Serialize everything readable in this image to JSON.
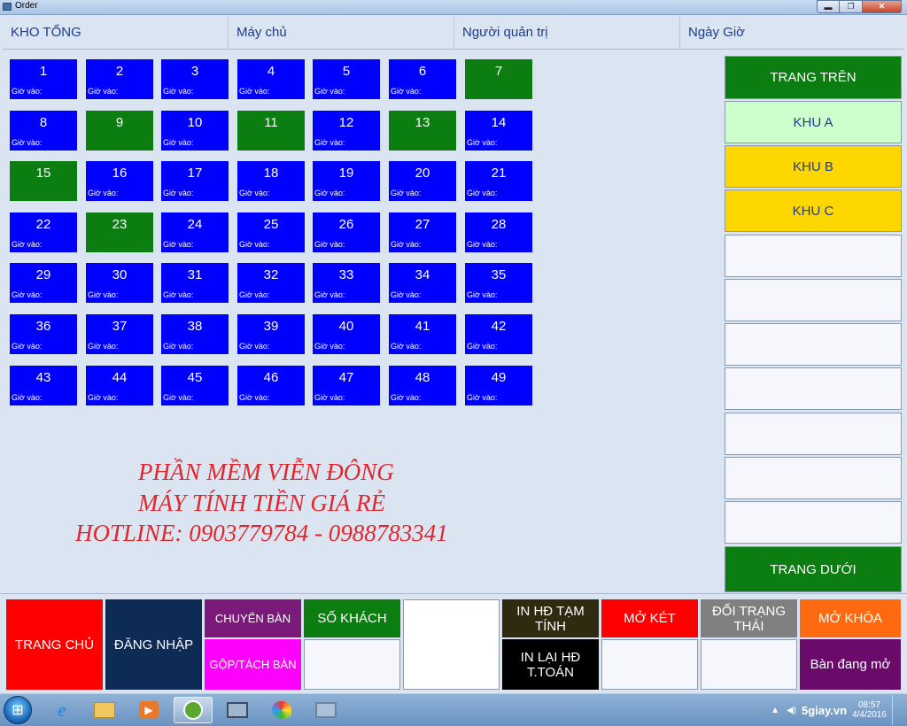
{
  "window": {
    "title": "Order",
    "min_label": "▬",
    "max_label": "❐",
    "close_label": "✕"
  },
  "header": {
    "area": "KHO TỔNG",
    "server": "Máy chủ",
    "user": "Người quản trị",
    "datetime": "Ngày  Giờ"
  },
  "tables": {
    "time_label": "Giờ vào:",
    "colors": {
      "empty": "#0000ff",
      "busy": "#0b7d11"
    },
    "items": [
      {
        "num": "1",
        "busy": false
      },
      {
        "num": "2",
        "busy": false
      },
      {
        "num": "3",
        "busy": false
      },
      {
        "num": "4",
        "busy": false
      },
      {
        "num": "5",
        "busy": false
      },
      {
        "num": "6",
        "busy": false
      },
      {
        "num": "7",
        "busy": true
      },
      {
        "num": "8",
        "busy": false
      },
      {
        "num": "9",
        "busy": true
      },
      {
        "num": "10",
        "busy": false
      },
      {
        "num": "11",
        "busy": true
      },
      {
        "num": "12",
        "busy": false
      },
      {
        "num": "13",
        "busy": true
      },
      {
        "num": "14",
        "busy": false
      },
      {
        "num": "15",
        "busy": true
      },
      {
        "num": "16",
        "busy": false
      },
      {
        "num": "17",
        "busy": false
      },
      {
        "num": "18",
        "busy": false
      },
      {
        "num": "19",
        "busy": false
      },
      {
        "num": "20",
        "busy": false
      },
      {
        "num": "21",
        "busy": false
      },
      {
        "num": "22",
        "busy": false
      },
      {
        "num": "23",
        "busy": true
      },
      {
        "num": "24",
        "busy": false
      },
      {
        "num": "25",
        "busy": false
      },
      {
        "num": "26",
        "busy": false
      },
      {
        "num": "27",
        "busy": false
      },
      {
        "num": "28",
        "busy": false
      },
      {
        "num": "29",
        "busy": false
      },
      {
        "num": "30",
        "busy": false
      },
      {
        "num": "31",
        "busy": false
      },
      {
        "num": "32",
        "busy": false
      },
      {
        "num": "33",
        "busy": false
      },
      {
        "num": "34",
        "busy": false
      },
      {
        "num": "35",
        "busy": false
      },
      {
        "num": "36",
        "busy": false
      },
      {
        "num": "37",
        "busy": false
      },
      {
        "num": "38",
        "busy": false
      },
      {
        "num": "39",
        "busy": false
      },
      {
        "num": "40",
        "busy": false
      },
      {
        "num": "41",
        "busy": false
      },
      {
        "num": "42",
        "busy": false
      },
      {
        "num": "43",
        "busy": false
      },
      {
        "num": "44",
        "busy": false
      },
      {
        "num": "45",
        "busy": false
      },
      {
        "num": "46",
        "busy": false
      },
      {
        "num": "47",
        "busy": false
      },
      {
        "num": "48",
        "busy": false
      },
      {
        "num": "49",
        "busy": false
      }
    ]
  },
  "promo": {
    "line1": "PHẦN MỀM VIỄN ĐÔNG",
    "line2": "MÁY TÍNH TIỀN GIÁ RẺ",
    "line3": "HOTLINE: 0903779784 - 0988783341"
  },
  "right_panel": {
    "page_up": "TRANG TRÊN",
    "area_a": "KHU A",
    "area_b": "KHU B",
    "area_c": "KHU C",
    "page_down": "TRANG DƯỚI"
  },
  "bottom": {
    "home": "TRANG CHỦ",
    "login": "ĐĂNG NHẬP",
    "move_table": "CHUYỂN BÀN",
    "merge_split": "GỘP/TÁCH  BÀN",
    "guest_count": "SỐ KHÁCH",
    "print_temp": "IN HĐ TẠM TÍNH",
    "reprint": "IN LẠI HĐ T.TOÁN",
    "open_drawer": "MỞ KÉT",
    "change_status": "ĐỔI TRẠNG THÁI",
    "unlock": "MỞ KHÓA",
    "open_tables": "Bàn đang mở"
  },
  "taskbar": {
    "clock_time": "08:57",
    "clock_date": "4/4/2016",
    "watermark": "5giay.vn"
  }
}
